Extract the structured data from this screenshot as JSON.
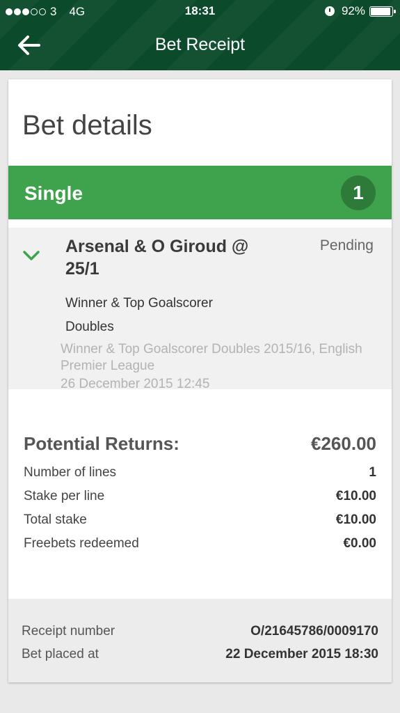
{
  "status_bar": {
    "carrier": "3",
    "network": "4G",
    "time": "18:31",
    "battery": "92%",
    "icons": [
      "signal-dots",
      "alarm-icon",
      "battery-icon"
    ]
  },
  "nav": {
    "title": "Bet Receipt",
    "back_icon": "back-arrow-icon"
  },
  "card": {
    "title": "Bet details",
    "bet_type": "Single",
    "bet_count": "1",
    "selection": {
      "name": "Arsenal & O Giroud @ 25/1",
      "status": "Pending",
      "market": "Winner & Top Goalscorer Doubles",
      "event": "Winner & Top Goalscorer Doubles 2015/16, English Premier League",
      "event_time": "26 December 2015 12:45"
    },
    "returns": {
      "label": "Potential Returns:",
      "value": "€260.00"
    },
    "details": [
      {
        "label": "Number of lines",
        "value": "1"
      },
      {
        "label": "Stake per line",
        "value": "€10.00"
      },
      {
        "label": "Total stake",
        "value": "€10.00"
      },
      {
        "label": "Freebets redeemed",
        "value": "€0.00"
      }
    ],
    "receipt": {
      "number_label": "Receipt number",
      "number_value": "O/21645786/0009170",
      "placed_label": "Bet placed at",
      "placed_value": "22 December 2015 18:30"
    }
  },
  "colors": {
    "header": "#0b4a2a",
    "bet_type_bar": "#3ea34c",
    "badge": "#2e7a38",
    "selection_bg": "#f1f1f1"
  }
}
